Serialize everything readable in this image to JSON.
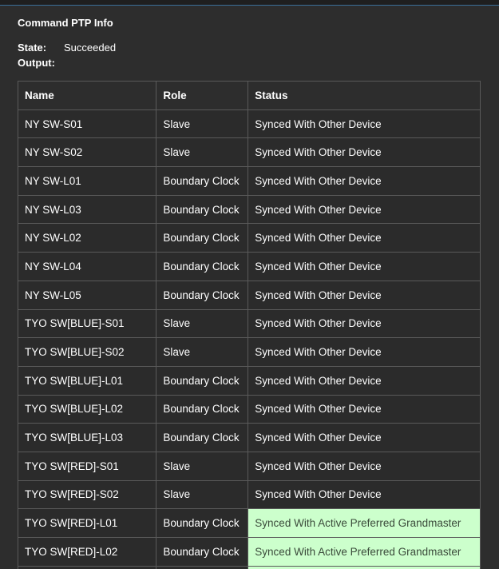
{
  "panel": {
    "title": "Command PTP Info",
    "state_label": "State:",
    "state_value": "Succeeded",
    "output_label": "Output:"
  },
  "table": {
    "headers": [
      "Name",
      "Role",
      "Status"
    ],
    "rows": [
      {
        "name": "NY SW-S01",
        "role": "Slave",
        "status": "Synced With Other Device",
        "highlight": false
      },
      {
        "name": "NY SW-S02",
        "role": "Slave",
        "status": "Synced With Other Device",
        "highlight": false
      },
      {
        "name": "NY SW-L01",
        "role": "Boundary Clock",
        "status": "Synced With Other Device",
        "highlight": false
      },
      {
        "name": "NY SW-L03",
        "role": "Boundary Clock",
        "status": "Synced With Other Device",
        "highlight": false
      },
      {
        "name": "NY SW-L02",
        "role": "Boundary Clock",
        "status": "Synced With Other Device",
        "highlight": false
      },
      {
        "name": "NY SW-L04",
        "role": "Boundary Clock",
        "status": "Synced With Other Device",
        "highlight": false
      },
      {
        "name": "NY SW-L05",
        "role": "Boundary Clock",
        "status": "Synced With Other Device",
        "highlight": false
      },
      {
        "name": "TYO SW[BLUE]-S01",
        "role": "Slave",
        "status": "Synced With Other Device",
        "highlight": false
      },
      {
        "name": "TYO SW[BLUE]-S02",
        "role": "Slave",
        "status": "Synced With Other Device",
        "highlight": false
      },
      {
        "name": "TYO SW[BLUE]-L01",
        "role": "Boundary Clock",
        "status": "Synced With Other Device",
        "highlight": false
      },
      {
        "name": "TYO SW[BLUE]-L02",
        "role": "Boundary Clock",
        "status": "Synced With Other Device",
        "highlight": false
      },
      {
        "name": "TYO SW[BLUE]-L03",
        "role": "Boundary Clock",
        "status": "Synced With Other Device",
        "highlight": false
      },
      {
        "name": "TYO SW[RED]-S01",
        "role": "Slave",
        "status": "Synced With Other Device",
        "highlight": false
      },
      {
        "name": "TYO SW[RED]-S02",
        "role": "Slave",
        "status": "Synced With Other Device",
        "highlight": false
      },
      {
        "name": "TYO SW[RED]-L01",
        "role": "Boundary Clock",
        "status": "Synced With Active Preferred Grandmaster",
        "highlight": true
      },
      {
        "name": "TYO SW[RED]-L02",
        "role": "Boundary Clock",
        "status": "Synced With Active Preferred Grandmaster",
        "highlight": true
      },
      {
        "name": "",
        "role": "",
        "status": "",
        "highlight": true
      }
    ]
  },
  "colors": {
    "background": "#2d2d2d",
    "grid": "#5a5a5a",
    "highlight_bg": "#ccffcc",
    "highlight_text": "#3a4a3a",
    "accent_border": "#3a6f9a"
  }
}
